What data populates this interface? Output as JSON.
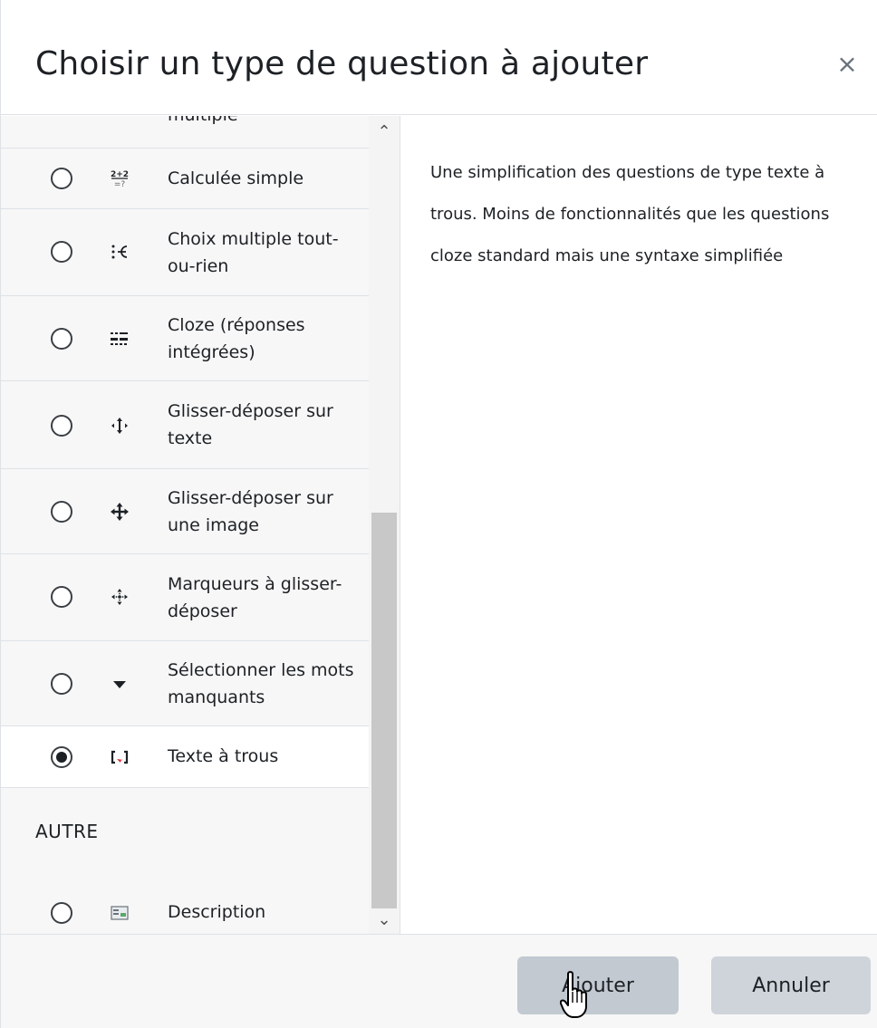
{
  "header": {
    "title": "Choisir un type de question à ajouter",
    "close_label": "×"
  },
  "options": [
    {
      "label": "multiple",
      "icon": "multichoice-icon",
      "checked": false
    },
    {
      "label": "Calculée simple",
      "icon": "calculated-simple-icon",
      "checked": false
    },
    {
      "label": "Choix multiple tout-ou-rien",
      "icon": "multichoice-all-or-nothing-icon",
      "checked": false
    },
    {
      "label": "Cloze (réponses intégrées)",
      "icon": "cloze-icon",
      "checked": false
    },
    {
      "label": "Glisser-déposer sur texte",
      "icon": "drag-drop-text-icon",
      "checked": false
    },
    {
      "label": "Glisser-déposer sur une image",
      "icon": "drag-drop-image-icon",
      "checked": false
    },
    {
      "label": "Marqueurs à glisser-déposer",
      "icon": "drag-drop-markers-icon",
      "checked": false
    },
    {
      "label": "Sélectionner les mots manquants",
      "icon": "select-missing-words-icon",
      "checked": false
    },
    {
      "label": "Texte à trous",
      "icon": "gapfill-icon",
      "checked": true
    }
  ],
  "other_section": {
    "heading": "AUTRE",
    "options": [
      {
        "label": "Description",
        "icon": "description-icon",
        "checked": false
      }
    ]
  },
  "summary": {
    "text": "Une simplification des questions de type texte à trous. Moins de fonctionnalités que les questions cloze standard mais une syntaxe simplifiée"
  },
  "footer": {
    "add_label": "Ajouter",
    "cancel_label": "Annuler"
  },
  "colors": {
    "panel_bg": "#f7f7f7",
    "border": "#dee2e6",
    "button_bg": "#ced4da",
    "text": "#1d2125"
  }
}
